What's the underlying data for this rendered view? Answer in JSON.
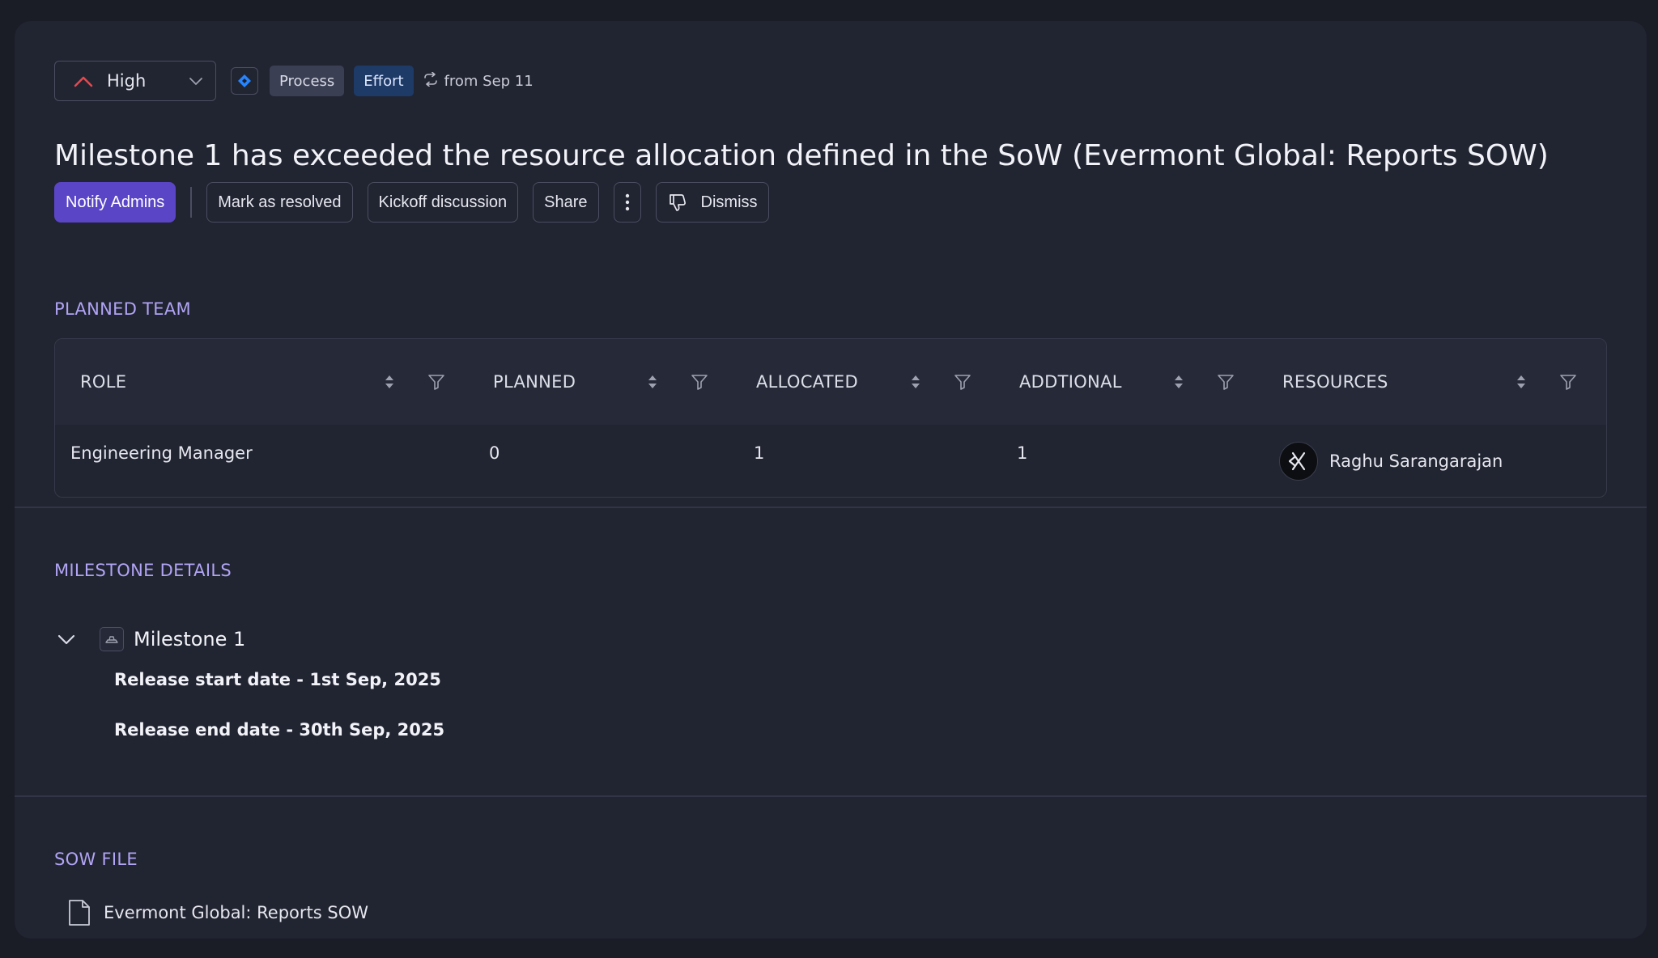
{
  "header": {
    "priority": "High",
    "tags": [
      "Process",
      "Effort"
    ],
    "since": "from Sep 11",
    "title": "Milestone 1 has exceeded the resource allocation defined in the SoW (Evermont Global: Reports SOW)"
  },
  "actions": {
    "notify": "Notify Admins",
    "resolve": "Mark as resolved",
    "kickoff": "Kickoff discussion",
    "share": "Share",
    "dismiss": "Dismiss"
  },
  "planned_team": {
    "label": "PLANNED TEAM",
    "columns": [
      "ROLE",
      "PLANNED",
      "ALLOCATED",
      "ADDTIONAL",
      "RESOURCES"
    ],
    "rows": [
      {
        "role": "Engineering Manager",
        "planned": "0",
        "allocated": "1",
        "additional": "1",
        "resource": "Raghu Sarangarajan"
      }
    ]
  },
  "milestone": {
    "label": "MILESTONE DETAILS",
    "name": "Milestone 1",
    "start": "Release start date - 1st Sep, 2025",
    "end": "Release end date - 30th Sep, 2025"
  },
  "sow": {
    "label": "SOW FILE",
    "file": "Evermont Global: Reports SOW"
  },
  "colors": {
    "accent": "#5a45c7",
    "section_label": "#b0a4f4",
    "priority_high": "#e5484d",
    "jira": "#2684ff"
  }
}
